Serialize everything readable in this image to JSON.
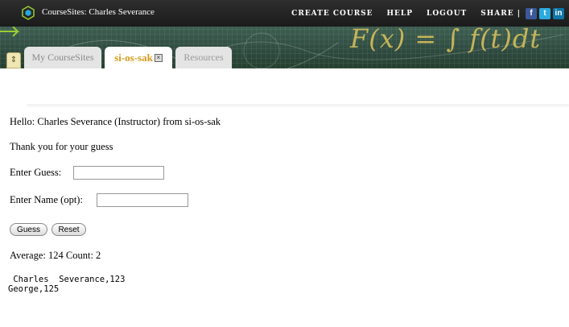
{
  "header": {
    "site_title": "CourseSites: Charles Severance",
    "nav": [
      "CREATE COURSE",
      "HELP",
      "LOGOUT"
    ],
    "share_label": "SHARE |",
    "social": [
      "f",
      "t",
      "in"
    ]
  },
  "banner": {
    "formula": "F(x) = ∫ f(t)dt"
  },
  "tabs": [
    {
      "label": "My CourseSites"
    },
    {
      "label": "si-os-sak",
      "close": "×"
    },
    {
      "label": "Resources"
    }
  ],
  "tab_handle": "⇕",
  "main": {
    "hello": "Hello: Charles Severance (Instructor) from si-os-sak",
    "message": "Thank you for your guess",
    "guess_label": "Enter Guess:",
    "guess_value": "",
    "name_label": "Enter Name (opt):",
    "name_value": "",
    "guess_button": "Guess",
    "reset_button": "Reset",
    "average": "Average: 124 Count: 2",
    "output": " Charles  Severance,123\nGeorge,125"
  },
  "colors": {
    "topbar": "#1b1b1b",
    "banner": "#2e4a3f",
    "active_tab_text": "#d49a17"
  }
}
